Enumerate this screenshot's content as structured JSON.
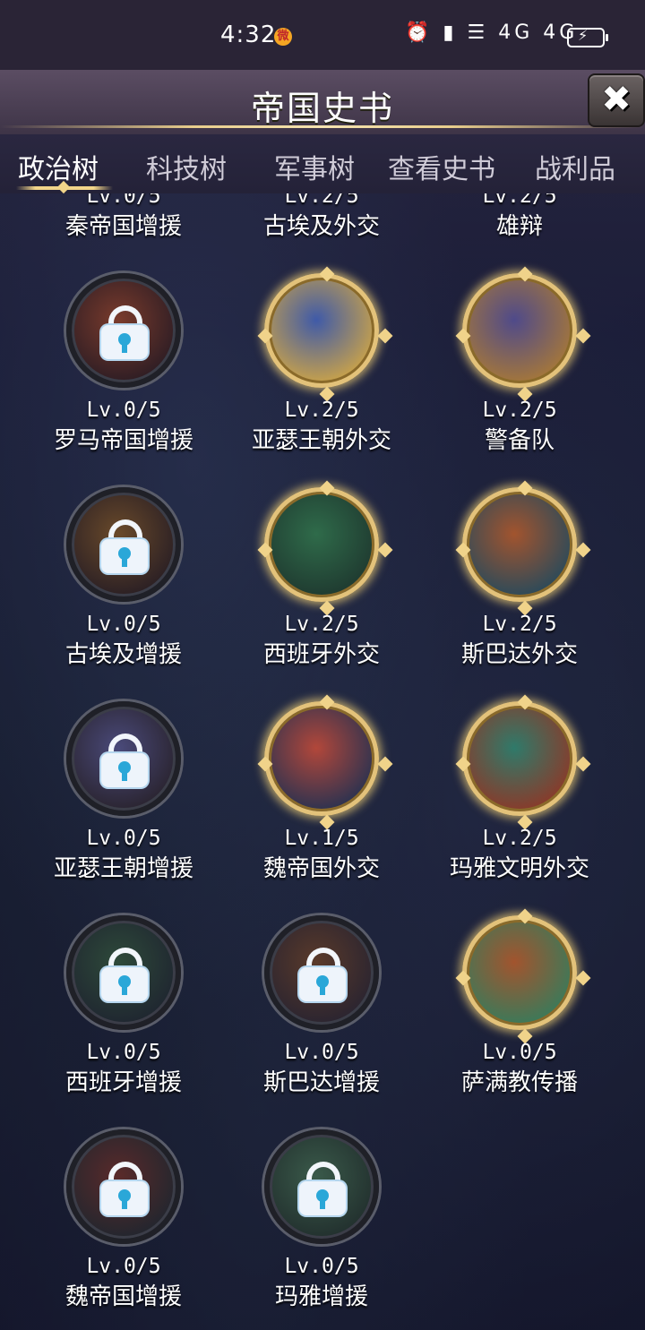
{
  "status_bar": {
    "time": "4:32",
    "weibo_icon": "微",
    "right_icons": "⏰ ▮ ☰ 4G 4G",
    "battery_icon": "battery-charging"
  },
  "header": {
    "title": "帝国史书",
    "close_label": "✖"
  },
  "tabs": [
    {
      "label": "政治树",
      "active": true
    },
    {
      "label": "科技树",
      "active": false
    },
    {
      "label": "军事树",
      "active": false
    },
    {
      "label": "查看史书",
      "active": false
    },
    {
      "label": "战利品",
      "active": false
    }
  ],
  "items": [
    {
      "level": "Lv.0/5",
      "name": "秦帝国增援",
      "locked": true,
      "palette": [
        "#5a3d35",
        "#2d2230"
      ]
    },
    {
      "level": "Lv.2/5",
      "name": "古埃及外交",
      "locked": false,
      "palette": [
        "#3a4a7a",
        "#2a2a3a"
      ]
    },
    {
      "level": "Lv.2/5",
      "name": "雄辩",
      "locked": false,
      "palette": [
        "#5a4a7a",
        "#2a2a3a"
      ]
    },
    {
      "level": "Lv.0/5",
      "name": "罗马帝国增援",
      "locked": true,
      "palette": [
        "#7a3b2c",
        "#2e1d24"
      ]
    },
    {
      "level": "Lv.2/5",
      "name": "亚瑟王朝外交",
      "locked": false,
      "palette": [
        "#3f5aa8",
        "#c9a24a"
      ]
    },
    {
      "level": "Lv.2/5",
      "name": "警备队",
      "locked": false,
      "palette": [
        "#4f4a8a",
        "#a5773a"
      ]
    },
    {
      "level": "Lv.0/5",
      "name": "古埃及增援",
      "locked": true,
      "palette": [
        "#6a4a2a",
        "#2a1f24"
      ]
    },
    {
      "level": "Lv.2/5",
      "name": "西班牙外交",
      "locked": false,
      "palette": [
        "#2f6b4a",
        "#1f3a30"
      ]
    },
    {
      "level": "Lv.2/5",
      "name": "斯巴达外交",
      "locked": false,
      "palette": [
        "#a2542e",
        "#2a4a5a"
      ]
    },
    {
      "level": "Lv.0/5",
      "name": "亚瑟王朝增援",
      "locked": true,
      "palette": [
        "#4a4a7a",
        "#2a2430"
      ]
    },
    {
      "level": "Lv.1/5",
      "name": "魏帝国外交",
      "locked": false,
      "palette": [
        "#b2473a",
        "#2a3250"
      ]
    },
    {
      "level": "Lv.2/5",
      "name": "玛雅文明外交",
      "locked": false,
      "palette": [
        "#2f7a6a",
        "#8a3a2a"
      ]
    },
    {
      "level": "Lv.0/5",
      "name": "西班牙增援",
      "locked": true,
      "palette": [
        "#2e4a3a",
        "#1f2630"
      ]
    },
    {
      "level": "Lv.0/5",
      "name": "斯巴达增援",
      "locked": true,
      "palette": [
        "#5a3a2a",
        "#2a2430"
      ]
    },
    {
      "level": "Lv.0/5",
      "name": "萨满教传播",
      "locked": false,
      "palette": [
        "#a2542e",
        "#3a7a5a"
      ]
    },
    {
      "level": "Lv.0/5",
      "name": "魏帝国增援",
      "locked": true,
      "palette": [
        "#5a2a2a",
        "#22262e"
      ]
    },
    {
      "level": "Lv.0/5",
      "name": "玛雅增援",
      "locked": true,
      "palette": [
        "#3a5a4a",
        "#22302e"
      ]
    }
  ]
}
